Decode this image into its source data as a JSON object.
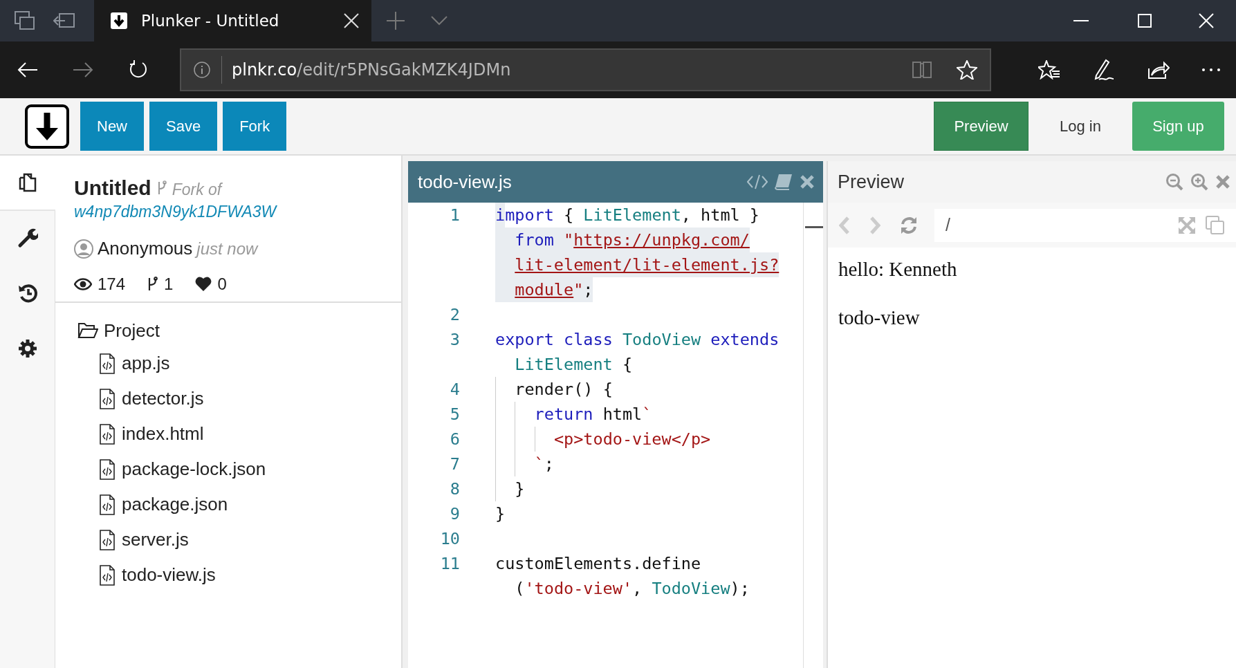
{
  "browser": {
    "tab": {
      "title": "Plunker - Untitled"
    },
    "address": {
      "host": "plnkr.co",
      "path": "/edit/r5PNsGakMZK4JDMn"
    }
  },
  "toolbar": {
    "left_buttons": [
      {
        "label": "New"
      },
      {
        "label": "Save"
      },
      {
        "label": "Fork"
      }
    ],
    "right_buttons": [
      {
        "label": "Preview",
        "kind": "dark"
      },
      {
        "label": "Log in",
        "kind": "plain"
      },
      {
        "label": "Sign up",
        "kind": "primary"
      }
    ]
  },
  "rail": [
    {
      "selected": true
    },
    {
      "selected": false
    },
    {
      "selected": false
    },
    {
      "selected": false
    }
  ],
  "plunk": {
    "title": "Untitled",
    "fork_label": "Fork of",
    "fork_source": "w4np7dbm3N9yk1DFWA3W",
    "author": "Anonymous",
    "time": "just now",
    "views": "174",
    "forks": "1",
    "likes": "0"
  },
  "project": {
    "name": "Project",
    "files": [
      {
        "name": "app.js"
      },
      {
        "name": "detector.js"
      },
      {
        "name": "index.html"
      },
      {
        "name": "package-lock.json"
      },
      {
        "name": "package.json"
      },
      {
        "name": "server.js"
      },
      {
        "name": "todo-view.js"
      }
    ]
  },
  "editor": {
    "filename": "todo-view.js",
    "lines": [
      {
        "number": "1",
        "highlighted": true,
        "rows": [
          {
            "tokens": [
              {
                "text": "import",
                "kind": "keyword"
              },
              {
                "text": " { ",
                "kind": "plain"
              },
              {
                "text": "LitElement",
                "kind": "def"
              },
              {
                "text": ", html }",
                "kind": "plain"
              }
            ]
          },
          {
            "tokens": [
              {
                "text": "from ",
                "kind": "keyword"
              },
              {
                "text": "\"",
                "kind": "string"
              },
              {
                "text": "https://unpkg.com/",
                "kind": "link"
              }
            ]
          },
          {
            "tokens": [
              {
                "text": "lit-element/lit-element.js?",
                "kind": "link"
              }
            ]
          },
          {
            "tokens": [
              {
                "text": "module",
                "kind": "link"
              },
              {
                "text": "\"",
                "kind": "string"
              },
              {
                "text": ";",
                "kind": "plain"
              }
            ]
          }
        ]
      },
      {
        "number": "2",
        "highlighted": false,
        "rows": [
          {
            "tokens": []
          }
        ]
      },
      {
        "number": "3",
        "highlighted": false,
        "rows": [
          {
            "tokens": [
              {
                "text": "export class ",
                "kind": "keyword"
              },
              {
                "text": "TodoView ",
                "kind": "def"
              },
              {
                "text": "extends",
                "kind": "keyword"
              }
            ]
          },
          {
            "tokens": [
              {
                "text": "LitElement",
                "kind": "def"
              },
              {
                "text": " {",
                "kind": "plain"
              }
            ]
          }
        ]
      },
      {
        "number": "4",
        "highlighted": false,
        "rows": [
          {
            "tokens": [
              {
                "text": "  render() {",
                "kind": "plain"
              }
            ]
          }
        ]
      },
      {
        "number": "5",
        "highlighted": false,
        "rows": [
          {
            "tokens": [
              {
                "text": "    return",
                "kind": "keyword"
              },
              {
                "text": " html",
                "kind": "plain"
              },
              {
                "text": "`",
                "kind": "string"
              }
            ]
          }
        ]
      },
      {
        "number": "6",
        "highlighted": false,
        "rows": [
          {
            "tokens": [
              {
                "text": "      <p>todo-view</p>",
                "kind": "string"
              }
            ]
          }
        ]
      },
      {
        "number": "7",
        "highlighted": false,
        "rows": [
          {
            "tokens": [
              {
                "text": "    `",
                "kind": "string"
              },
              {
                "text": ";",
                "kind": "plain"
              }
            ]
          }
        ]
      },
      {
        "number": "8",
        "highlighted": false,
        "rows": [
          {
            "tokens": [
              {
                "text": "  }",
                "kind": "plain"
              }
            ]
          }
        ]
      },
      {
        "number": "9",
        "highlighted": false,
        "rows": [
          {
            "tokens": [
              {
                "text": "}",
                "kind": "plain"
              }
            ]
          }
        ]
      },
      {
        "number": "10",
        "highlighted": false,
        "rows": [
          {
            "tokens": []
          }
        ]
      },
      {
        "number": "11",
        "highlighted": false,
        "rows": [
          {
            "tokens": [
              {
                "text": "customElements.define",
                "kind": "plain"
              }
            ]
          },
          {
            "tokens": [
              {
                "text": "(",
                "kind": "plain"
              },
              {
                "text": "'todo-view'",
                "kind": "string"
              },
              {
                "text": ", ",
                "kind": "plain"
              },
              {
                "text": "TodoView",
                "kind": "def"
              },
              {
                "text": ");",
                "kind": "plain"
              }
            ]
          }
        ]
      }
    ]
  },
  "preview": {
    "title": "Preview",
    "path": "/",
    "content": [
      "hello: Kenneth",
      "todo-view"
    ]
  }
}
